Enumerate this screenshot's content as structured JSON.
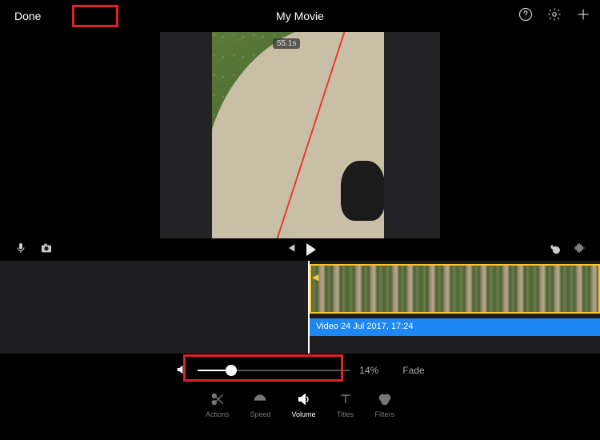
{
  "header": {
    "done_label": "Done",
    "title": "My Movie"
  },
  "preview": {
    "time_badge": "55.1s"
  },
  "timeline": {
    "clip_label": "Video 24 Jul 2017, 17:24"
  },
  "volume": {
    "percent_label": "14%",
    "fade_label": "Fade",
    "fill_percent": 22
  },
  "tabs": {
    "actions": "Actions",
    "speed": "Speed",
    "volume": "Volume",
    "titles": "Titles",
    "filters": "Filters"
  },
  "icons": {
    "help": "help-icon",
    "gear": "gear-icon",
    "plus": "plus-icon",
    "mic": "mic-icon",
    "camera": "camera-icon",
    "skip_back": "skip-back-icon",
    "play": "play-icon",
    "undo": "undo-icon",
    "waveform": "waveform-icon",
    "speaker": "speaker-icon"
  }
}
